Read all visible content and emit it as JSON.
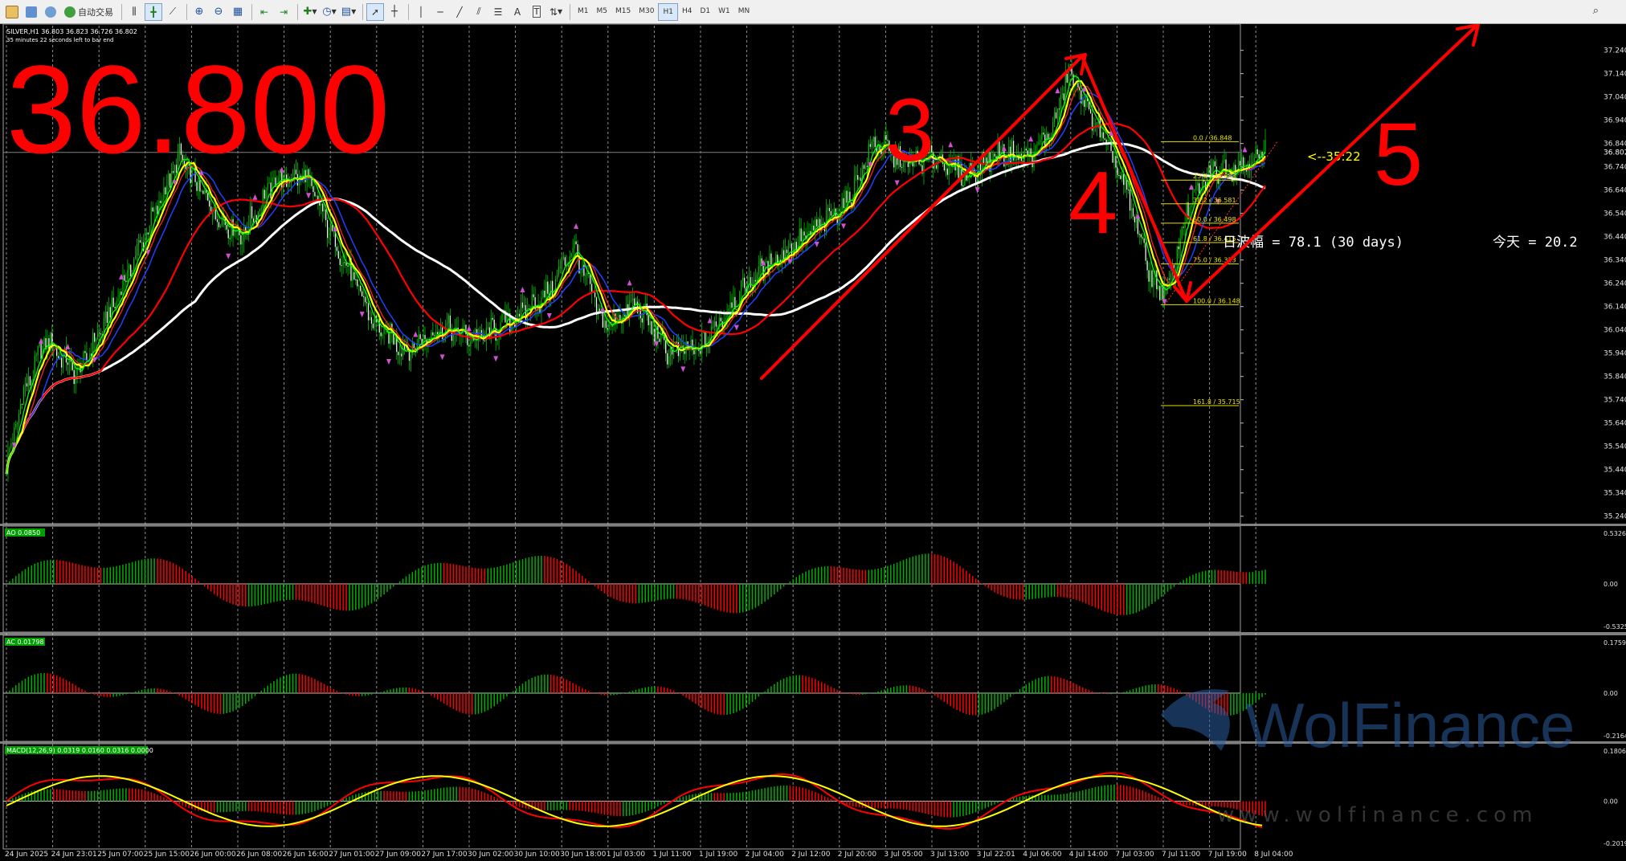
{
  "toolbar": {
    "auto_trading_label": "自动交易",
    "timeframes": [
      "M1",
      "M5",
      "M15",
      "M30",
      "H1",
      "H4",
      "D1",
      "W1",
      "MN"
    ]
  },
  "main": {
    "symbol_info": "SILVER,H1 36.803 36.823 36.726 36.802",
    "countdown": "35 minutes 22 seconds left to bar end",
    "big_price": "36.800",
    "countdown_arrow": "<--35:22",
    "daily_range": "日波幅 = 78.1  (30 days)",
    "today_label": "今天 = 20.2",
    "current_price_tag": "36.802",
    "annotations": [
      "3",
      "4",
      "5"
    ],
    "price_axis": [
      "37.240",
      "37.140",
      "37.040",
      "36.940",
      "36.840",
      "36.740",
      "36.640",
      "36.540",
      "36.440",
      "36.340",
      "36.240",
      "36.140",
      "36.040",
      "35.940",
      "35.840",
      "35.740",
      "35.640",
      "35.540",
      "35.440",
      "35.340",
      "35.240"
    ],
    "fibonacci": [
      {
        "label": "0.0 / 36.848",
        "price": 36.848
      },
      {
        "label": "23.6 / 36.683",
        "price": 36.683
      },
      {
        "label": "38.2 / 36.581",
        "price": 36.581
      },
      {
        "label": "50.0 / 36.498",
        "price": 36.498
      },
      {
        "label": "61.8 / 36.415",
        "price": 36.415
      },
      {
        "label": "75.0 / 36.323",
        "price": 36.323
      },
      {
        "label": "100.0 / 36.148",
        "price": 36.148
      },
      {
        "label": "161.8 / 35.715",
        "price": 35.715
      }
    ]
  },
  "time_axis": [
    "24 Jun 2025",
    "24 Jun 23:01",
    "25 Jun 07:00",
    "25 Jun 15:00",
    "26 Jun 00:00",
    "26 Jun 08:00",
    "26 Jun 16:00",
    "27 Jun 01:00",
    "27 Jun 09:00",
    "27 Jun 17:00",
    "30 Jun 02:00",
    "30 Jun 10:00",
    "30 Jun 18:00",
    "1 Jul 03:00",
    "1 Jul 11:00",
    "1 Jul 19:00",
    "2 Jul 04:00",
    "2 Jul 12:00",
    "2 Jul 20:00",
    "3 Jul 05:00",
    "3 Jul 13:00",
    "3 Jul 22:01",
    "4 Jul 06:00",
    "4 Jul 14:00",
    "7 Jul 03:00",
    "7 Jul 11:00",
    "7 Jul 19:00",
    "8 Jul 04:00"
  ],
  "ao": {
    "label": "AO 0.0850",
    "top": "0.5326",
    "zero": "0.00",
    "bottom": "-0.5325"
  },
  "ac": {
    "label": "AC 0.01798",
    "top": "0.1759",
    "zero": "0.00",
    "bottom": "-0.2164"
  },
  "macd": {
    "label": "MACD(12,26,9) 0.0319 0.0160 0.0316 0.0000",
    "top": "0.1806",
    "zero": "0.00",
    "bottom": "-0.2019"
  },
  "watermark": {
    "brand": "WolFinance",
    "url": "www.wolfinance.com"
  },
  "colors": {
    "bull": "#00c000",
    "bear": "#ff0000",
    "background": "#000000",
    "fib": "#ffff00",
    "annotation": "#ff0000"
  }
}
